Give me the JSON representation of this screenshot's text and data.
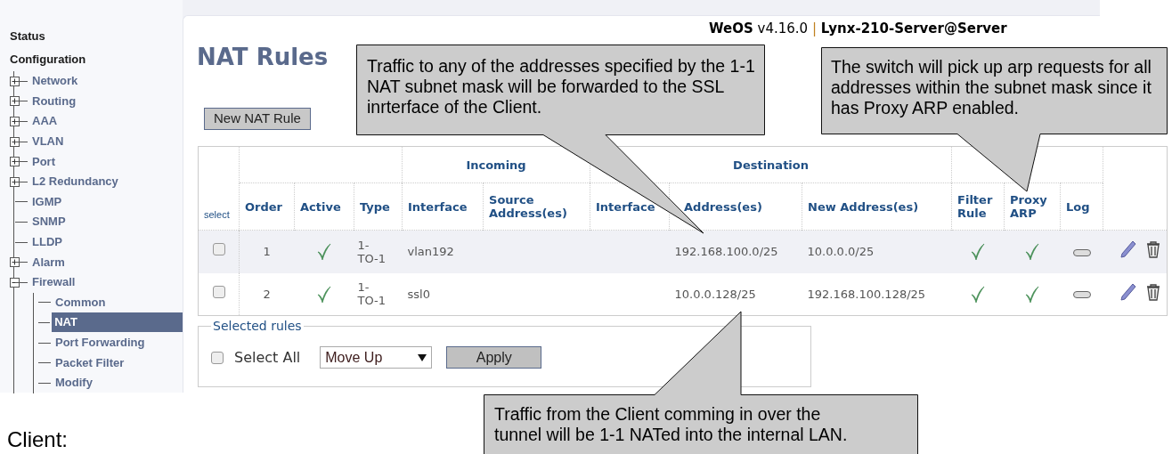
{
  "header": {
    "product": "WeOS",
    "version": "v4.16.0",
    "separator": "|",
    "device": "Lynx-210-Server@Server"
  },
  "sidebar": {
    "items": [
      {
        "label": "Status",
        "kind": "heading",
        "selected": false
      },
      {
        "label": "Configuration",
        "kind": "heading",
        "selected": false,
        "children": [
          {
            "label": "Network",
            "kind": "group",
            "expanded": false,
            "selected": false
          },
          {
            "label": "Routing",
            "kind": "group",
            "expanded": false,
            "selected": false
          },
          {
            "label": "AAA",
            "kind": "group",
            "expanded": false,
            "selected": false
          },
          {
            "label": "VLAN",
            "kind": "group",
            "expanded": false,
            "selected": false
          },
          {
            "label": "Port",
            "kind": "group",
            "expanded": false,
            "selected": false
          },
          {
            "label": "L2 Redundancy",
            "kind": "group",
            "expanded": false,
            "selected": false
          },
          {
            "label": "IGMP",
            "kind": "leaf",
            "selected": false
          },
          {
            "label": "SNMP",
            "kind": "leaf",
            "selected": false
          },
          {
            "label": "LLDP",
            "kind": "leaf",
            "selected": false
          },
          {
            "label": "Alarm",
            "kind": "group",
            "expanded": false,
            "selected": false
          },
          {
            "label": "Firewall",
            "kind": "group",
            "expanded": true,
            "selected": false,
            "children": [
              {
                "label": "Common",
                "kind": "leaf",
                "selected": false
              },
              {
                "label": "NAT",
                "kind": "leaf",
                "selected": true
              },
              {
                "label": "Port Forwarding",
                "kind": "leaf",
                "selected": false
              },
              {
                "label": "Packet Filter",
                "kind": "leaf",
                "selected": false
              },
              {
                "label": "Modify",
                "kind": "leaf",
                "selected": false
              }
            ]
          }
        ]
      }
    ]
  },
  "page": {
    "title": "NAT Rules",
    "new_button": "New NAT Rule"
  },
  "table": {
    "select_label": "select",
    "groups": [
      "Incoming",
      "Destination"
    ],
    "columns": [
      "Order",
      "Active",
      "Type",
      "Interface",
      "Source Address(es)",
      "Interface",
      "Address(es)",
      "New Address(es)",
      "Filter Rule",
      "Proxy ARP",
      "Log"
    ],
    "rows": [
      {
        "checked": false,
        "order": "1",
        "active": true,
        "type": "1-TO-1",
        "interface": "vlan192",
        "address": "192.168.100.0/25",
        "new_address": "10.0.0.0/25",
        "filter_rule": true,
        "proxy_arp": true,
        "log": false
      },
      {
        "checked": false,
        "order": "2",
        "active": true,
        "type": "1-TO-1",
        "interface": "ssl0",
        "address": "10.0.0.128/25",
        "new_address": "192.168.100.128/25",
        "filter_rule": true,
        "proxy_arp": true,
        "log": false
      }
    ]
  },
  "selected_rules": {
    "legend": "Selected rules",
    "select_all": {
      "label": "Select All",
      "checked": false
    },
    "action": "Move Up",
    "apply": "Apply"
  },
  "callouts": [
    {
      "text": "Traffic to any of the addresses specified by the 1-1 NAT subnet mask will be forwarded to the SSL inrterface of the Client."
    },
    {
      "text": "The switch will pick up arp requests for all addresses within the subnet mask since it has Proxy ARP enabled."
    },
    {
      "text": "Traffic from the Client comming in over the tunnel will be 1-1 NATed into the internal LAN."
    }
  ],
  "caption": "Client:"
}
